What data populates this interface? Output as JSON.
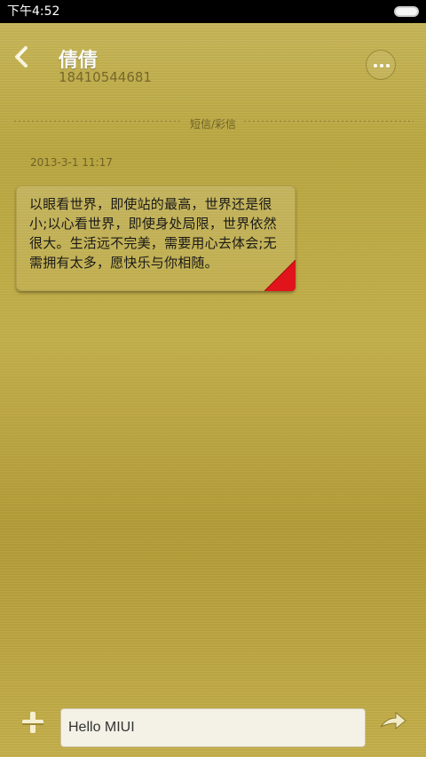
{
  "status_bar": {
    "time": "下午4:52"
  },
  "header": {
    "contact_name": "倩倩",
    "contact_number": "18410544681",
    "back_icon": "back-arrow-icon",
    "more_icon": "more-dots-icon"
  },
  "conversation": {
    "message_type_label": "短信/彩信",
    "messages": [
      {
        "timestamp": "2013-3-1 11:17",
        "text": "以眼看世界，即使站的最高，世界还是很小;以心看世界，即使身处局限，世界依然很大。生活远不完美，需要用心去体会;无需拥有太多，愿快乐与你相随。",
        "direction": "incoming"
      }
    ]
  },
  "composer": {
    "input_value": "Hello MIUI",
    "add_icon": "plus-icon",
    "send_icon": "send-arrow-icon"
  },
  "colors": {
    "background": "#b9a43a",
    "status_bar": "#000000",
    "bubble_corner": "#e0141a",
    "input_background": "#f4f1e6"
  }
}
